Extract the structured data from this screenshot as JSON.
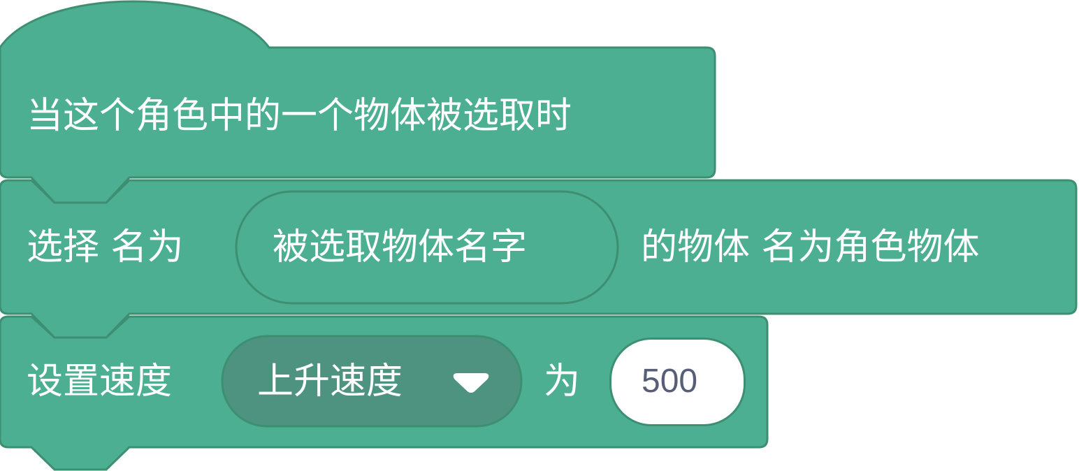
{
  "block_hat": {
    "label": "当这个角色中的一个物体被选取时"
  },
  "block_select": {
    "label_prefix": "选择 名为",
    "reporter": "被选取物体名字",
    "label_suffix": "的物体 名为角色物体"
  },
  "block_set_speed": {
    "label_prefix": "设置速度",
    "dropdown_value": "上升速度",
    "label_middle": "为",
    "value": "500"
  },
  "colors": {
    "block_fill": "#4caf92",
    "block_border": "#3d8f71",
    "reporter_fill": "#4caf92",
    "dropdown_fill": "#4e9380",
    "value_text": "#575e75"
  },
  "icons": {
    "dropdown": "triangle-down-icon"
  }
}
